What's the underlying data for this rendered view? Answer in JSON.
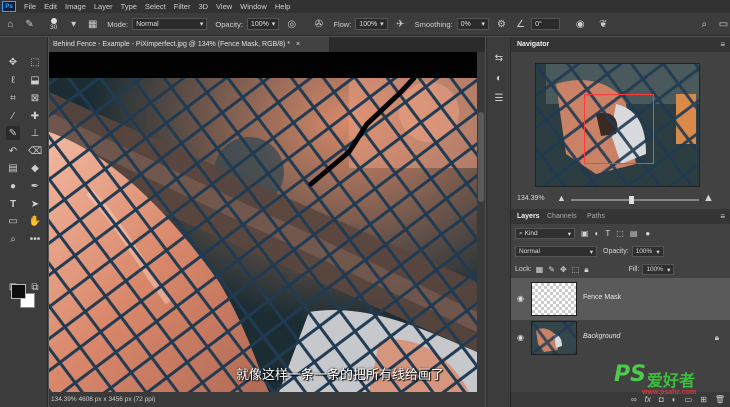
{
  "menu": {
    "logo": "Ps",
    "items": [
      "File",
      "Edit",
      "Image",
      "Layer",
      "Type",
      "Select",
      "Filter",
      "3D",
      "View",
      "Window",
      "Help"
    ]
  },
  "options": {
    "brush_size": "30",
    "mode_label": "Mode:",
    "mode_value": "Normal",
    "opacity_label": "Opacity:",
    "opacity_value": "100%",
    "flow_label": "Flow:",
    "flow_value": "100%",
    "smoothing_label": "Smoothing:",
    "smoothing_value": "0%",
    "angle_value": "0°"
  },
  "document": {
    "tab_title": "Behind Fence - Example - PiXimperfect.jpg @ 134% (Fence Mask, RGB/8) *",
    "close_glyph": "×",
    "status_text": "134.39%    4608 px x 3456 px (72 ppi)"
  },
  "subtitle": "就像这样一条一条的把所有线给画了",
  "navigator": {
    "tab_label": "Navigator",
    "zoom_value": "134.39%"
  },
  "layers_panel": {
    "tabs": [
      "Layers",
      "Channels",
      "Paths"
    ],
    "kind_label": "Kind",
    "blend_mode": "Normal",
    "opacity_label": "Opacity:",
    "opacity_value": "100%",
    "lock_label": "Lock:",
    "fill_label": "Fill:",
    "fill_value": "100%",
    "layers": [
      {
        "name": "Fence Mask",
        "selected": true
      },
      {
        "name": "Background",
        "selected": false
      }
    ]
  },
  "watermark": {
    "ps": "PS",
    "cn": "爱好者",
    "url": "www.psahz.com"
  },
  "colors": {
    "foreground": "#0e0e0e",
    "background": "#ffffff",
    "accent": "#31a8ff"
  }
}
